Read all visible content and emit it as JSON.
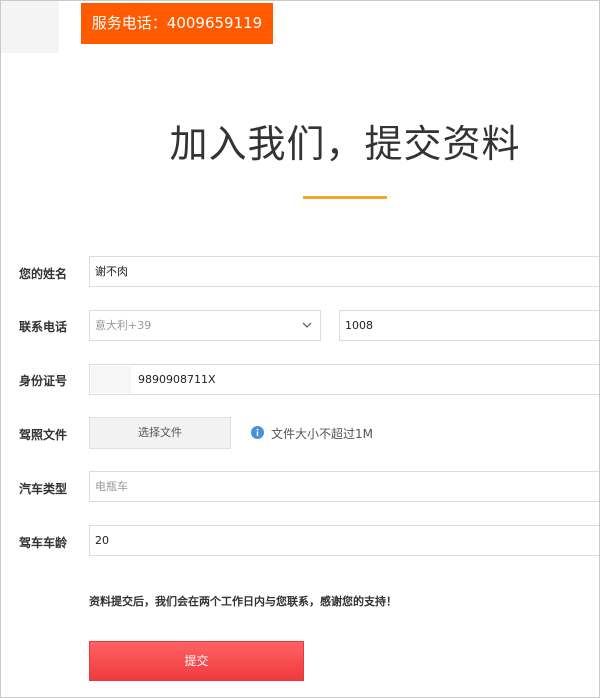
{
  "header": {
    "hotline_text": "服务电话：4009659119"
  },
  "page_title": "加入我们，提交资料",
  "form": {
    "name": {
      "label": "您的姓名",
      "value": "谢不肉"
    },
    "phone": {
      "label": "联系电话",
      "country_code": "意大利+39",
      "number": "1008"
    },
    "id_number": {
      "label": "身份证号",
      "value": "9890908711X"
    },
    "license": {
      "label": "驾照文件",
      "button_label": "选择文件",
      "hint": "文件大小不超过1M"
    },
    "car_type": {
      "label": "汽车类型",
      "placeholder": "电瓶车"
    },
    "driving_years": {
      "label": "驾车车龄",
      "value": "20"
    }
  },
  "notice": "资料提交后，我们会在两个工作日内与您联系，感谢您的支持！",
  "submit_label": "提交",
  "colors": {
    "hotline_bg": "#ff5a00",
    "title_underline": "#f5a623",
    "submit_bg": "#ef3a3e",
    "info_icon": "#4a90d9"
  },
  "icons": {
    "select_arrow": "chevron-down-icon",
    "file_hint": "info-icon"
  }
}
